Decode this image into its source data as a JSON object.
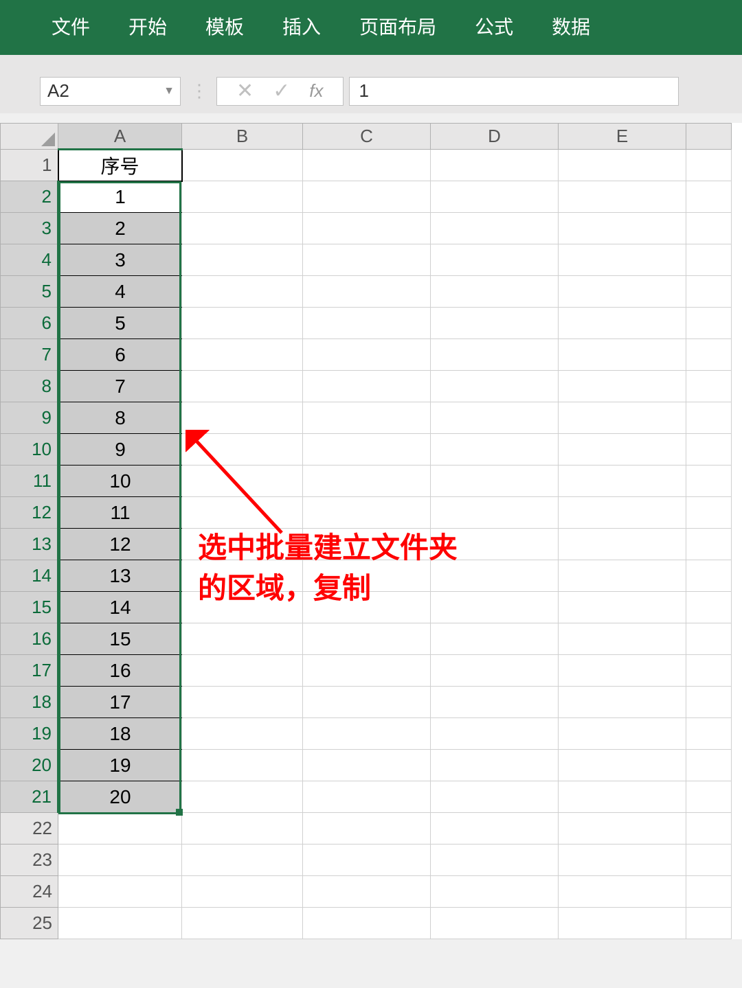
{
  "ribbon": {
    "items": [
      "文件",
      "开始",
      "模板",
      "插入",
      "页面布局",
      "公式",
      "数据"
    ]
  },
  "formula_bar": {
    "name_box": "A2",
    "formula_value": "1",
    "fx_label": "fx"
  },
  "columns": [
    "A",
    "B",
    "C",
    "D",
    "E"
  ],
  "rows": [
    {
      "num": "1",
      "A": "序号"
    },
    {
      "num": "2",
      "A": "1"
    },
    {
      "num": "3",
      "A": "2"
    },
    {
      "num": "4",
      "A": "3"
    },
    {
      "num": "5",
      "A": "4"
    },
    {
      "num": "6",
      "A": "5"
    },
    {
      "num": "7",
      "A": "6"
    },
    {
      "num": "8",
      "A": "7"
    },
    {
      "num": "9",
      "A": "8"
    },
    {
      "num": "10",
      "A": "9"
    },
    {
      "num": "11",
      "A": "10"
    },
    {
      "num": "12",
      "A": "11"
    },
    {
      "num": "13",
      "A": "12"
    },
    {
      "num": "14",
      "A": "13"
    },
    {
      "num": "15",
      "A": "14"
    },
    {
      "num": "16",
      "A": "15"
    },
    {
      "num": "17",
      "A": "16"
    },
    {
      "num": "18",
      "A": "17"
    },
    {
      "num": "19",
      "A": "18"
    },
    {
      "num": "20",
      "A": "19"
    },
    {
      "num": "21",
      "A": "20"
    },
    {
      "num": "22",
      "A": ""
    },
    {
      "num": "23",
      "A": ""
    },
    {
      "num": "24",
      "A": ""
    },
    {
      "num": "25",
      "A": ""
    }
  ],
  "annotation": {
    "line1": "选中批量建立文件夹",
    "line2": "的区域，复制"
  },
  "colors": {
    "ribbon_bg": "#217346",
    "selection_border": "#217346",
    "annotation_color": "#ff0000"
  }
}
